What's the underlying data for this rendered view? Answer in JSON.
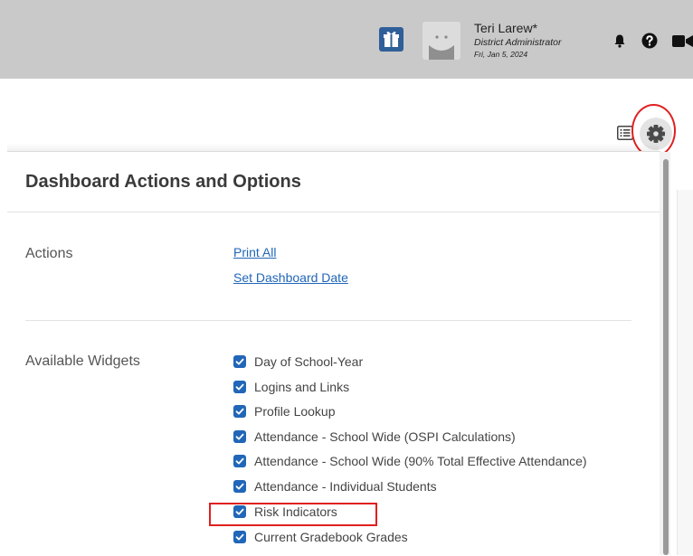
{
  "header": {
    "user_name": "Teri Larew*",
    "user_role": "District Administrator",
    "date": "Fri, Jan 5, 2024",
    "icons": [
      "gift-icon",
      "avatar",
      "bell-icon",
      "help-icon",
      "video-icon"
    ],
    "header_bg": "#c9c9c9",
    "gift_bg": "#2f5f99"
  },
  "toolbar": {
    "icons": [
      "list-view-icon",
      "gear-icon"
    ]
  },
  "panel": {
    "title": "Dashboard Actions and Options",
    "actions": {
      "label": "Actions",
      "links": [
        "Print All",
        "Set Dashboard Date"
      ]
    },
    "widgets": {
      "label": "Available Widgets",
      "items": [
        {
          "label": "Day of School-Year",
          "checked": true
        },
        {
          "label": "Logins and Links",
          "checked": true
        },
        {
          "label": "Profile Lookup",
          "checked": true
        },
        {
          "label": "Attendance - School Wide (OSPI Calculations)",
          "checked": true
        },
        {
          "label": "Attendance - School Wide (90% Total Effective Attendance)",
          "checked": true
        },
        {
          "label": "Attendance - Individual Students",
          "checked": true
        },
        {
          "label": "Risk Indicators",
          "checked": true
        },
        {
          "label": "Current Gradebook Grades",
          "checked": true
        }
      ]
    }
  },
  "colors": {
    "accent": "#2166b8",
    "annotation": "#e02020"
  }
}
